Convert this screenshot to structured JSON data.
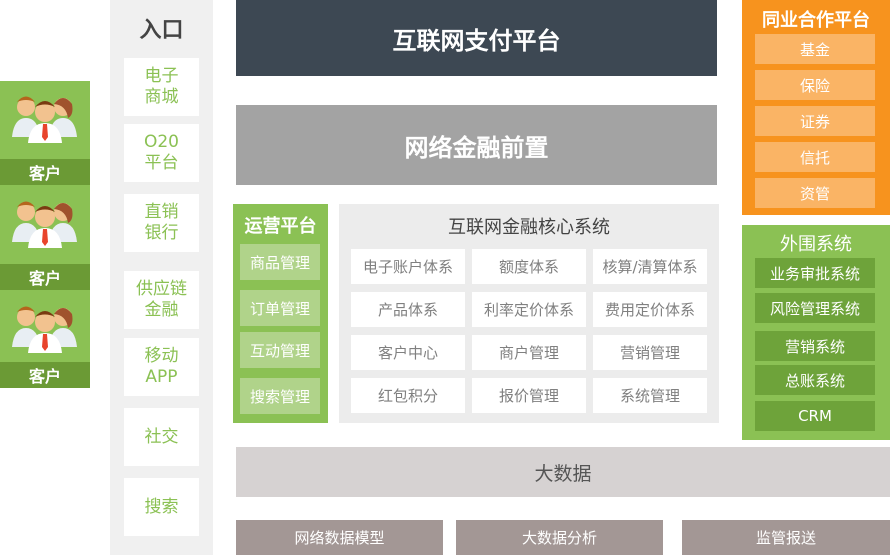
{
  "customers": {
    "label": "客户"
  },
  "entry": {
    "title": "入口",
    "items": [
      [
        "电子",
        "商城"
      ],
      [
        "O20",
        "平台"
      ],
      [
        "直销",
        "银行"
      ],
      [
        "供应链",
        "金融"
      ],
      [
        "移动",
        "APP"
      ],
      [
        "社交"
      ],
      [
        "搜索"
      ]
    ]
  },
  "platform": {
    "payment": "互联网支付平台",
    "finance_front": "网络金融前置"
  },
  "operations": {
    "title": "运营平台",
    "items": [
      "商品管理",
      "订单管理",
      "互动管理",
      "搜索管理"
    ]
  },
  "core": {
    "title": "互联网金融核心系统",
    "cells": [
      [
        "电子账户体系",
        "额度体系",
        "核算/清算体系"
      ],
      [
        "产品体系",
        "利率定价体系",
        "费用定价体系"
      ],
      [
        "客户中心",
        "商户管理",
        "营销管理"
      ],
      [
        "红包积分",
        "报价管理",
        "系统管理"
      ]
    ]
  },
  "bigdata": {
    "title": "大数据",
    "items": [
      "网络数据模型",
      "大数据分析",
      "监管报送"
    ]
  },
  "partners": {
    "title": "同业合作平台",
    "items": [
      "基金",
      "保险",
      "证券",
      "信托",
      "资管"
    ]
  },
  "peripheral": {
    "title": "外围系统",
    "items": [
      "业务审批系统",
      "风险管理系统",
      "营销系统",
      "总账系统",
      "CRM"
    ]
  },
  "colors": {
    "green": "#8bc154",
    "dark_green": "#6b9a35",
    "orange": "#f7931e",
    "dark_slate": "#3d4853",
    "grey": "#a3a3a3",
    "taupe": "#a39795"
  },
  "icons": {
    "customer": "people-group-icon"
  }
}
